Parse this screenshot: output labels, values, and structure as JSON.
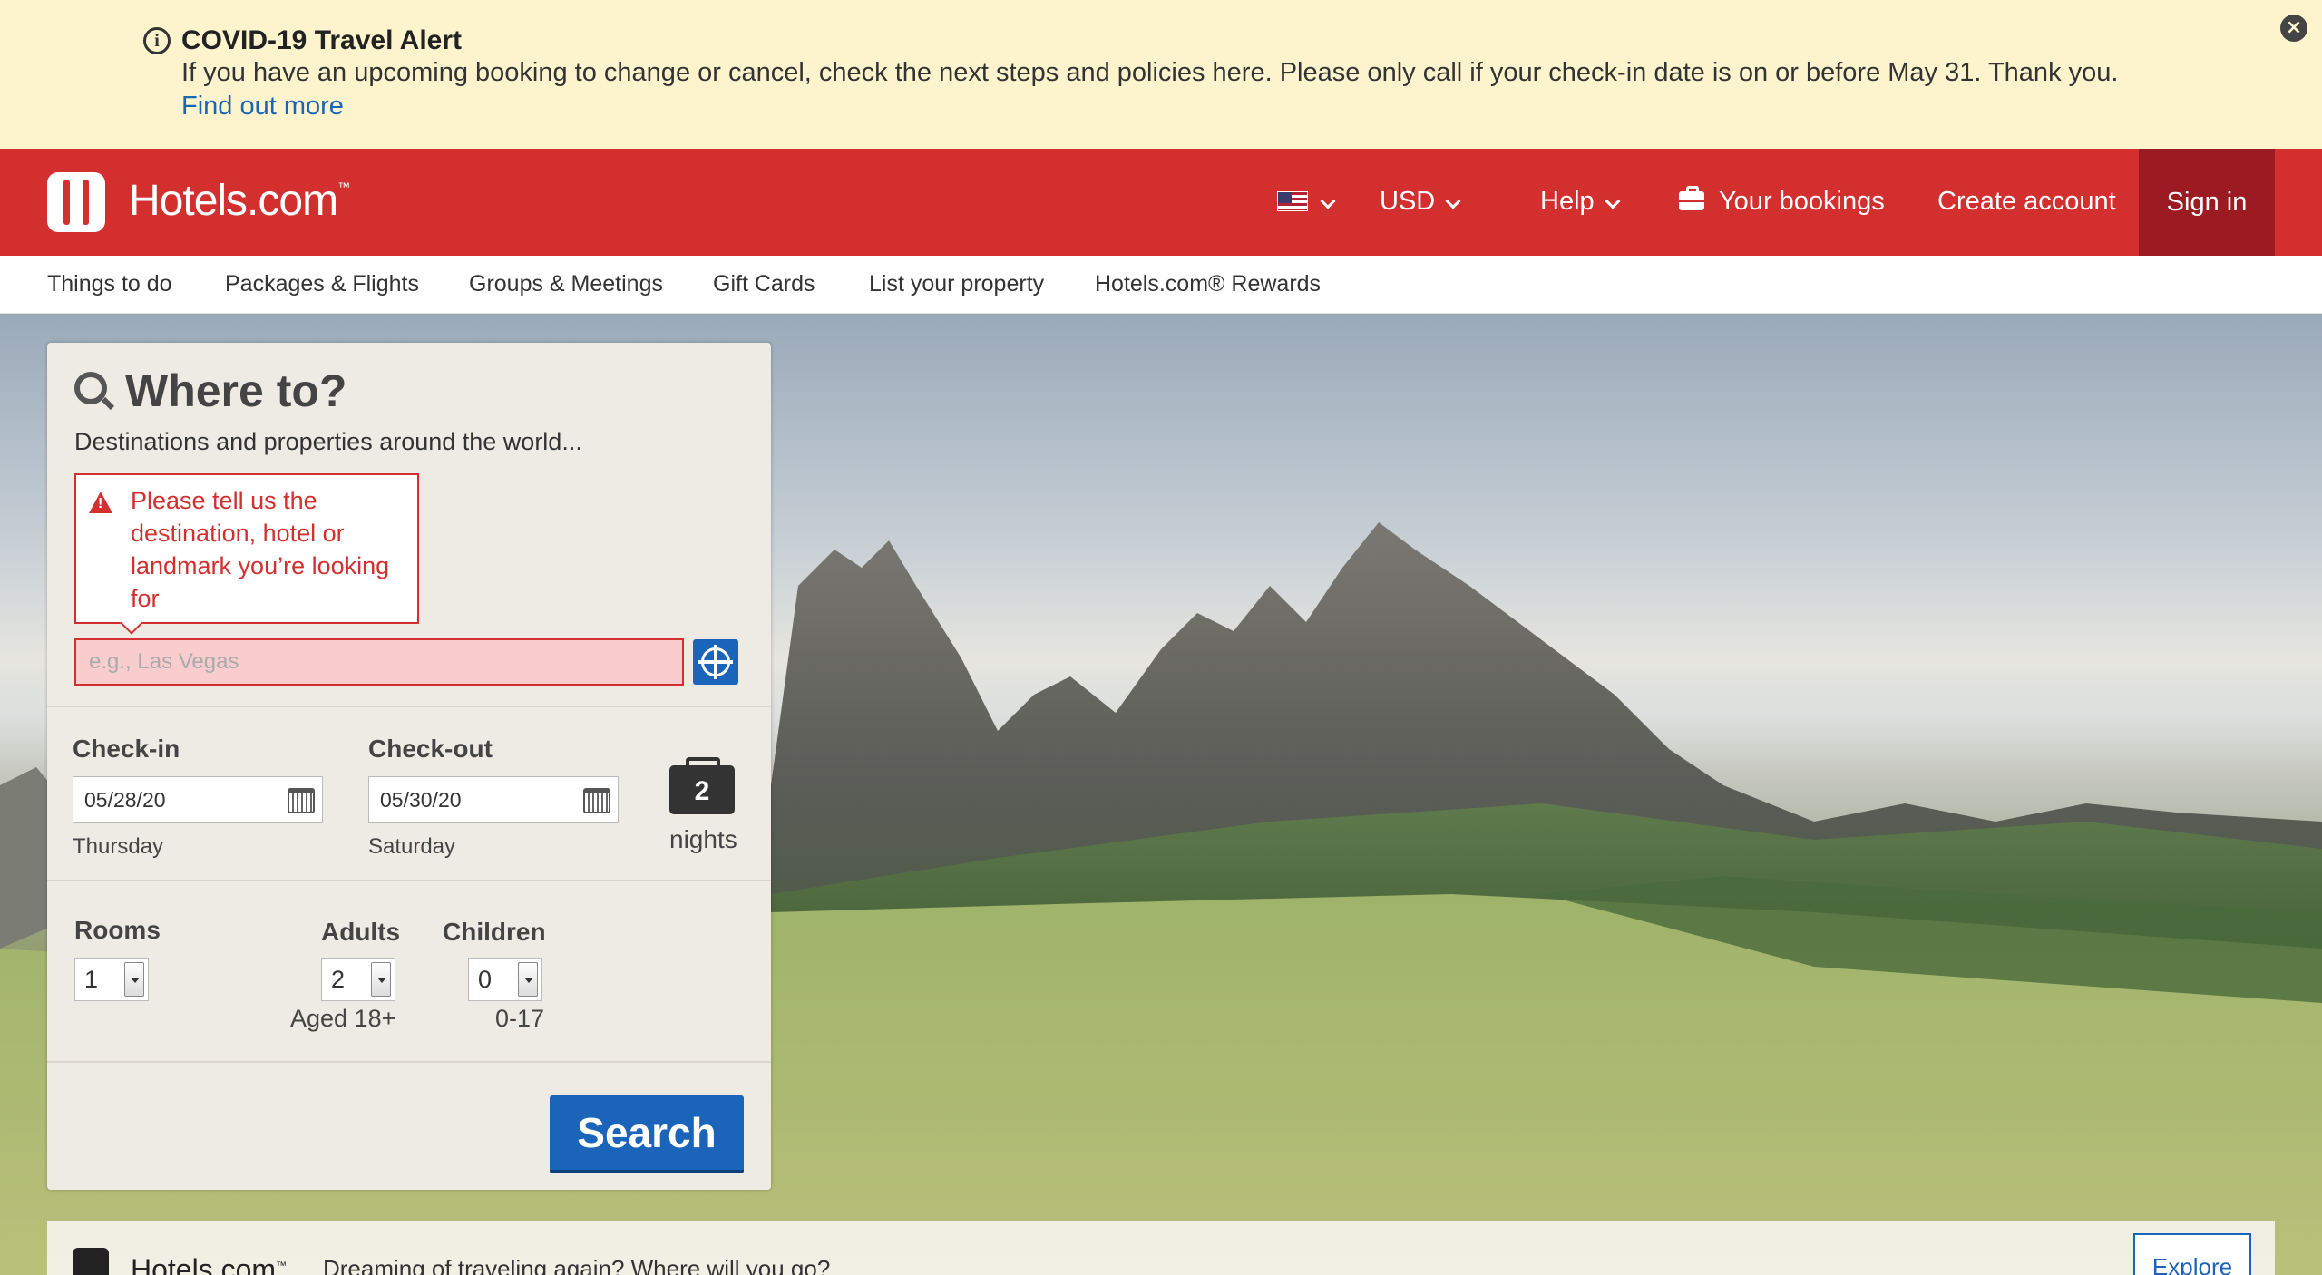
{
  "alert": {
    "title": "COVID-19 Travel Alert",
    "body": "If you have an upcoming booking to change or cancel, check the next steps and policies here. Please only call if your check-in date is on or before May 31. Thank you.",
    "link": "Find out more",
    "icon": "info-icon",
    "close_icon": "close-icon"
  },
  "header": {
    "logo_text": "Hotels.com",
    "logo_tm": "™",
    "currency": "USD",
    "help": "Help",
    "bookings": "Your bookings",
    "create_account": "Create account",
    "sign_in": "Sign in",
    "colors": {
      "brand": "#d32f2f",
      "sign_in_bg": "#9c1b22"
    }
  },
  "subnav": {
    "items": [
      "Things to do",
      "Packages & Flights",
      "Groups & Meetings",
      "Gift Cards",
      "List your property",
      "Hotels.com® Rewards"
    ]
  },
  "search": {
    "title": "Where to?",
    "subtitle": "Destinations and properties around the world...",
    "error": "Please tell us the destination, hotel or landmark you’re looking for",
    "destination_placeholder": "e.g., Las Vegas",
    "checkin_label": "Check-in",
    "checkin_value": "05/28/20",
    "checkin_day": "Thursday",
    "checkout_label": "Check-out",
    "checkout_value": "05/30/20",
    "checkout_day": "Saturday",
    "nights_count": "2",
    "nights_label": "nights",
    "rooms_label": "Rooms",
    "rooms_value": "1",
    "adults_label": "Adults",
    "adults_value": "2",
    "adults_sub": "Aged 18+",
    "children_label": "Children",
    "children_value": "0",
    "children_sub": "0-17",
    "search_button": "Search",
    "colors": {
      "primary": "#1a64b9",
      "error": "#d32f2f"
    }
  },
  "banner": {
    "logo_text": "Hotels.com",
    "logo_tm": "™",
    "text": "Dreaming of traveling again? Where will you go?",
    "button": "Explore"
  }
}
